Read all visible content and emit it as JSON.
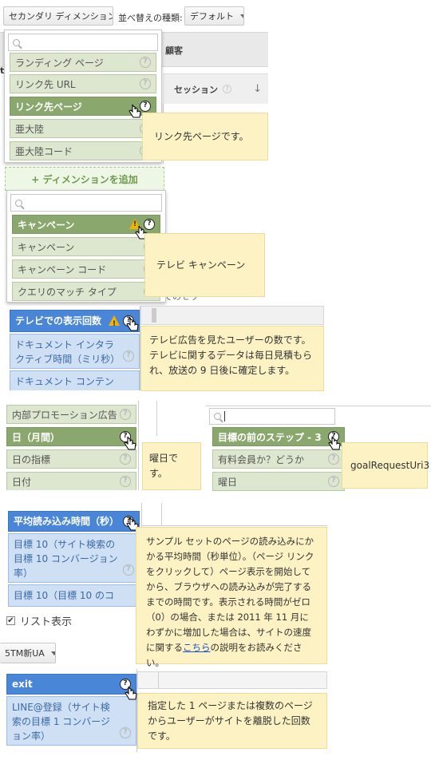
{
  "panel1": {
    "secondary_dimension_label": "セカンダリ ディメンション",
    "sort_type_label": "並べ替えの種類:",
    "sort_value": "デフォルト",
    "header_partial": "顧客",
    "left_partial": "t",
    "sessions_label": "セッション",
    "items": [
      "ランディング ページ",
      "リンク先 URL",
      "リンク先ページ",
      "亜大陸",
      "亜大陸コード"
    ],
    "tooltip": "リンク先ページです。"
  },
  "panel2": {
    "add_dimension_label": "+ ディメンションを追加",
    "items": [
      "キャンペーン",
      "キャンペーン",
      "キャンペーン コード",
      "クエリのマッチ タイプ"
    ],
    "behind_text": "でのセッ",
    "tooltip": "テレビ キャンペーン"
  },
  "panel3": {
    "items": [
      "テレビでの表示回数",
      "ドキュメント インタラクティブ時間（ミリ秒）",
      "ドキュメント コンテンツ"
    ],
    "tooltip": "テレビ広告を見たユーザーの数です。テレビに関するデータは毎日見積もられ、放送の 9 日後に確定します。"
  },
  "panel4": {
    "items": [
      "内部プロモーション広告",
      "日（月間）",
      "日の指標",
      "日付"
    ],
    "tooltip": "曜日です。"
  },
  "panel5": {
    "items": [
      "目標の前のステップ - 3",
      "有料会員か？どうか",
      "曜日"
    ],
    "tooltip": "goalRequestUri3"
  },
  "panel6": {
    "items": [
      "平均読み込み時間（秒）",
      "目標 10（サイト検索の目標 10 コンバージョン率）",
      "目標 10（目標 10 のコン"
    ],
    "list_view_label": "リスト表示",
    "ua_button_label": "5TM新UA",
    "tooltip_before_link": "サンプル セットのページの読み込みにかかる平均時間（秒単位）。（ページ リンクをクリックして）ページ表示を開始してから、ブラウザへの読み込みが完了するまでの時間です。表示される時間がゼロ（0）の場合、または 2011 年 11 月にわずかに増加した場合は、サイトの速度に関する",
    "tooltip_link": "こちら",
    "tooltip_after_link": "の説明をお読みください。"
  },
  "panel7": {
    "items": [
      "exit",
      "LINE@登録（サイト検索の目標 1 コンバージョン率）"
    ],
    "tooltip": "指定した 1 ページまたは複数のページからユーザーがサイトを離脱した回数です。"
  },
  "icons": {
    "help": "?",
    "sort_down": "↓"
  },
  "colors": {
    "green_selected": "#8aa86d",
    "green": "#dde7cf",
    "blue_selected": "#4a86d8",
    "blue": "#cfe0f5",
    "tooltip_bg": "#fdf2c3"
  }
}
